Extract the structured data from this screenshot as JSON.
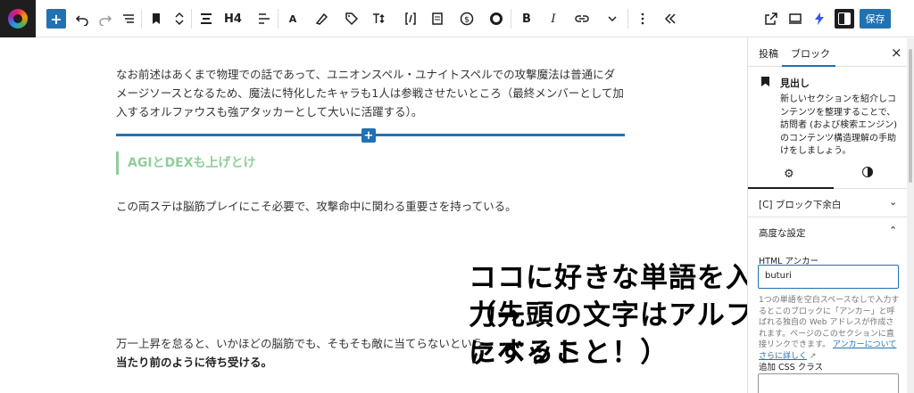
{
  "toolbar": {
    "add": "+",
    "heading_level": "H4",
    "text_a": "A",
    "bold": "B",
    "italic": "I",
    "save": "保存"
  },
  "editor": {
    "paragraph1": "なお前述はあくまで物理での話であって、ユニオンスペル・ユナイトスペルでの攻撃魔法は普通にダメージソースとなるため、魔法に特化したキャラも1人は参戦させたいところ（最終メンバーとして加入するオルファウスも強アタッカーとして大いに活躍する）。",
    "heading": "AGIとDEXも上げとけ",
    "paragraph2": "この両ステは脳筋プレイにこそ必要で、攻撃命中に関わる重要さを持っている。",
    "paragraph3_normal": "万一上昇を怠ると、いかほどの脳筋でも、そもそも敵に当てらないという",
    "paragraph3_bold": "当たり前のように待ち受ける。"
  },
  "annotation": {
    "line1": "ココに好きな単語を入力→",
    "line2": "（先頭の文字はアルファベット",
    "line3": "にすること！）"
  },
  "sidebar": {
    "tab_post": "投稿",
    "tab_block": "ブロック",
    "close": "×",
    "block_name": "見出し",
    "block_description": "新しいセクションを紹介しコンテンツを整理することで、訪問者 (および検索エンジン) のコンテンツ構造理解の手助けをしましょう。",
    "section1_title": "[C] ブロック下余白",
    "section2_title": "高度な設定",
    "anchor_label": "HTML アンカー",
    "anchor_value": "buturi",
    "help_text": "1つの単語を空白スペースなしで入力するとこのブロックに「アンカー」と呼ばれる独自の Web アドレスが作成されます。ページのこのセクションに直接リンクできます。",
    "help_link": "アンカーについてさらに詳しく",
    "css_label": "追加 CSS クラス"
  },
  "icons": [
    "undo-icon",
    "redo-icon",
    "list-view-icon",
    "bookmark-icon",
    "move-icon",
    "align-icon",
    "text-align-icon",
    "highlight-icon",
    "tag-icon",
    "line-height-icon",
    "shortcode-icon",
    "doc-icon",
    "dollar-icon",
    "circle-icon",
    "link-icon",
    "more-icon",
    "options-icon",
    "collapse-icon",
    "external-icon",
    "preview-icon",
    "lightning-icon",
    "sidebar-toggle-icon",
    "gear-icon",
    "contrast-icon"
  ],
  "colors": {
    "accent": "#2271b1",
    "heading_green": "#8fce9b"
  }
}
